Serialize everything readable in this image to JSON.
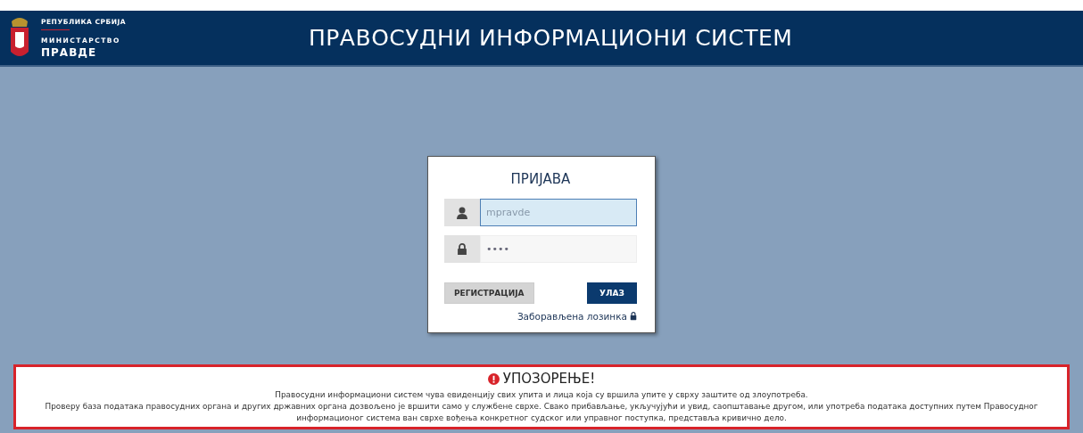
{
  "header": {
    "country": "РЕПУБЛИКА СРБИЈА",
    "ministry": "МИНИСТАРСТВО",
    "ministry_name": "ПРАВДЕ",
    "title": "ПРАВОСУДНИ ИНФОРМАЦИОНИ СИСТЕМ"
  },
  "login": {
    "title": "ПРИЈАВА",
    "username": {
      "value": "mpravde",
      "focused": true
    },
    "password": {
      "value": "••••",
      "focused": false
    },
    "register_button": "РЕГИСТРАЦИЈА",
    "login_button": "УЛАЗ",
    "forgot_link": "Заборављена лозинка"
  },
  "warning": {
    "title": "УПОЗОРЕЊЕ!",
    "lines": [
      "Правосудни информациони систем чува евиденцију свих упита и лица која су вршила упите у сврху заштите од злоупотреба.",
      "Проверу база података правосудних органа и других државних органа дозвољено је вршити само у службене сврхе. Свако прибављање, укључујући и увид, саопштавање другом, или употреба података доступних путем Правосудног информационог система ван сврхе вођења конкретног судског или управног поступка, представља кривично дело."
    ]
  }
}
